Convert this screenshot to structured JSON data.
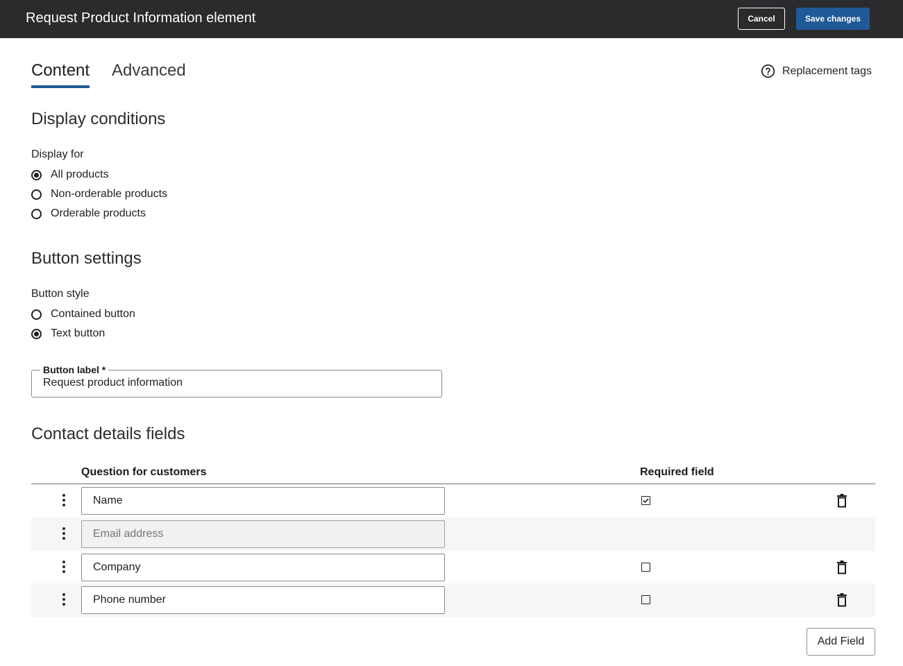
{
  "header": {
    "title": "Request Product Information element",
    "cancel_label": "Cancel",
    "save_label": "Save changes"
  },
  "tabs": [
    {
      "label": "Content",
      "active": true
    },
    {
      "label": "Advanced",
      "active": false
    }
  ],
  "replacement_tags": {
    "label": "Replacement tags",
    "icon": "help-circle-icon"
  },
  "display_conditions": {
    "title": "Display conditions",
    "group_label": "Display for",
    "options": [
      {
        "label": "All products",
        "checked": true
      },
      {
        "label": "Non-orderable products",
        "checked": false
      },
      {
        "label": "Orderable products",
        "checked": false
      }
    ]
  },
  "button_settings": {
    "title": "Button settings",
    "style_label": "Button style",
    "options": [
      {
        "label": "Contained button",
        "checked": false
      },
      {
        "label": "Text button",
        "checked": true
      }
    ],
    "label_field": {
      "label": "Button label *",
      "value": "Request product information"
    }
  },
  "contact_fields": {
    "title": "Contact details fields",
    "col_question": "Question for customers",
    "col_required": "Required field",
    "rows": [
      {
        "value": "Name",
        "placeholder": "",
        "disabled": false,
        "required": true,
        "deletable": true
      },
      {
        "value": "",
        "placeholder": "Email address",
        "disabled": true,
        "required": null,
        "deletable": false
      },
      {
        "value": "Company",
        "placeholder": "",
        "disabled": false,
        "required": false,
        "deletable": true
      },
      {
        "value": "Phone number",
        "placeholder": "",
        "disabled": false,
        "required": false,
        "deletable": true
      }
    ],
    "add_label": "Add Field"
  },
  "colors": {
    "topbar": "#2b2b2e",
    "accent": "#1f5a96",
    "row_alt": "#f6f6f7"
  }
}
